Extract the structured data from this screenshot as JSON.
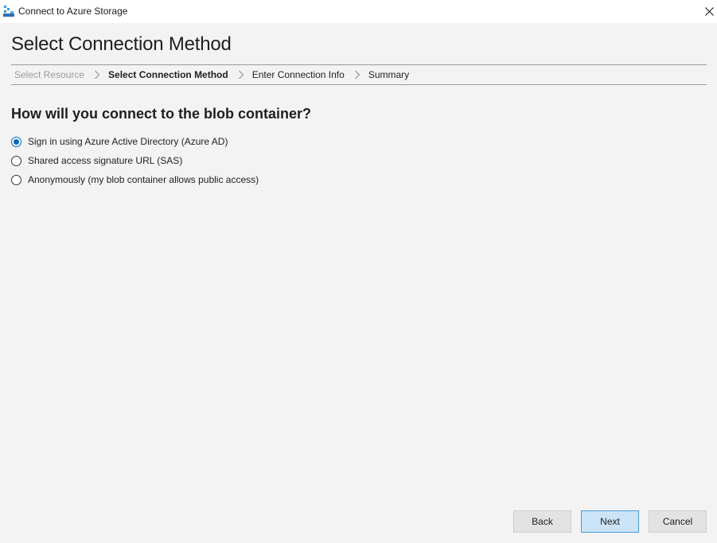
{
  "window": {
    "title": "Connect to Azure Storage",
    "close_icon": "close-icon",
    "app_icon": "azure-storage-icon"
  },
  "page": {
    "title": "Select Connection Method"
  },
  "breadcrumb": {
    "steps": [
      {
        "label": "Select Resource",
        "state": "done"
      },
      {
        "label": "Select Connection Method",
        "state": "active"
      },
      {
        "label": "Enter Connection Info",
        "state": "upcoming"
      },
      {
        "label": "Summary",
        "state": "upcoming"
      }
    ],
    "separator_icon": "chevron-right-icon"
  },
  "question": "How will you connect to the blob container?",
  "options": [
    {
      "label": "Sign in using Azure Active Directory (Azure AD)",
      "checked": true
    },
    {
      "label": "Shared access signature URL (SAS)",
      "checked": false
    },
    {
      "label": "Anonymously (my blob container allows public access)",
      "checked": false
    }
  ],
  "buttons": {
    "back": "Back",
    "next": "Next",
    "cancel": "Cancel"
  },
  "colors": {
    "accent": "#0067c0",
    "primary_button_bg": "#cce4f7",
    "background": "#f3f3f3"
  }
}
